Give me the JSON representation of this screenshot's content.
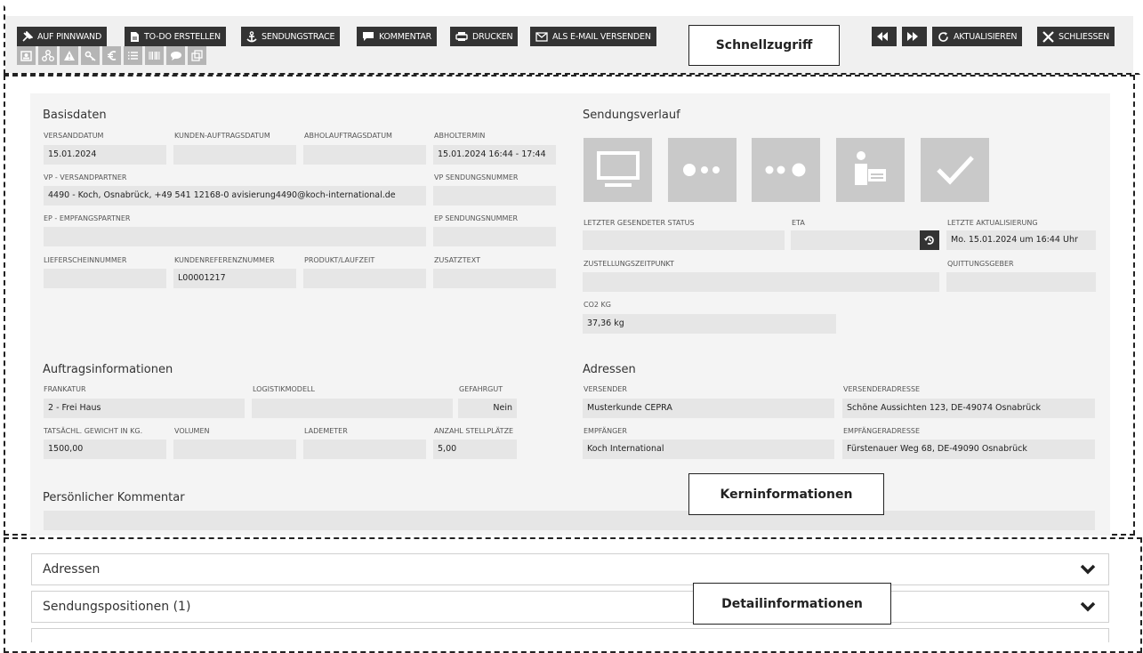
{
  "toolbar": {
    "pin": "AUF PINNWAND",
    "todo": "TO-DO ERSTELLEN",
    "trace": "SENDUNGSTRACE",
    "comment": "KOMMENTAR",
    "print": "DRUCKEN",
    "email": "ALS E-MAIL VERSENDEN",
    "refresh": "AKTUALISIEREN",
    "close": "SCHLIESSEN",
    "icon_row": [
      "contact-card-icon",
      "network-icon",
      "warning-icon",
      "key-icon",
      "euro-icon",
      "list-icon",
      "barcode-icon",
      "chat-icon",
      "duplicate-icon"
    ]
  },
  "callouts": {
    "quick": "Schnellzugriff",
    "core": "Kerninformationen",
    "detail": "Detailinformationen"
  },
  "basisdaten": {
    "title": "Basisdaten",
    "versanddatum_label": "VERSANDDATUM",
    "versanddatum": "15.01.2024",
    "kundenauftrag_label": "KUNDEN-AUFTRAGSDATUM",
    "kundenauftrag": "",
    "abholauftrag_label": "ABHOLAUFTRAGSDATUM",
    "abholauftrag": "",
    "abholtermin_label": "ABHOLTERMIN",
    "abholtermin": "15.01.2024 16:44 - 17:44",
    "vp_label": "VP - VERSANDPARTNER",
    "vp": "4490 - Koch, Osnabrück, +49 541 12168-0 avisierung4490@koch-international.de",
    "vp_nr_label": "VP SENDUNGSNUMMER",
    "vp_nr": "",
    "ep_label": "EP - EMPFANGSPARTNER",
    "ep": "",
    "ep_nr_label": "EP SENDUNGSNUMMER",
    "ep_nr": "",
    "lieferschein_label": "LIEFERSCHEINNUMMER",
    "lieferschein": "",
    "kundenref_label": "KUNDENREFERENZNUMMER",
    "kundenref": "L00001217",
    "produkt_label": "PRODUKT/LAUFZEIT",
    "produkt": "",
    "zusatz_label": "ZUSATZTEXT",
    "zusatz": ""
  },
  "verlauf": {
    "title": "Sendungsverlauf",
    "steps": [
      "computer-icon",
      "dots-partial-icon",
      "dots-icon",
      "delivery-person-icon",
      "checkmark-icon"
    ],
    "status_label": "LETZTER GESENDETER STATUS",
    "status": "",
    "eta_label": "ETA",
    "eta": "",
    "update_label": "LETZTE AKTUALISIERUNG",
    "update": "Mo. 15.01.2024 um 16:44 Uhr",
    "zustellung_label": "ZUSTELLUNGSZEITPUNKT",
    "zustellung": "",
    "quittung_label": "QUITTUNGSGEBER",
    "quittung": "",
    "co2_label": "CO2 KG",
    "co2": "37,36 kg"
  },
  "auftrag": {
    "title": "Auftragsinformationen",
    "frankatur_label": "FRANKATUR",
    "frankatur": "2 - Frei Haus",
    "logistik_label": "LOGISTIKMODELL",
    "logistik": "",
    "gefahrgut_label": "GEFAHRGUT",
    "gefahrgut": "Nein",
    "gewicht_label": "TATSÄCHL. GEWICHT IN KG.",
    "gewicht": "1500,00",
    "volumen_label": "VOLUMEN",
    "volumen": "",
    "lademeter_label": "LADEMETER",
    "lademeter": "",
    "stellplaetze_label": "ANZAHL STELLPLÄTZE",
    "stellplaetze": "5,00"
  },
  "adressen": {
    "title": "Adressen",
    "versender_label": "VERSENDER",
    "versender": "Musterkunde CEPRA",
    "versender_adr_label": "VERSENDERADRESSE",
    "versender_adr": "Schöne Aussichten 123, DE-49074 Osnabrück",
    "empf_label": "EMPFÄNGER",
    "empf": "Koch International",
    "empf_adr_label": "EMPFÄNGERADRESSE",
    "empf_adr": "Fürstenauer Weg 68, DE-49090 Osnabrück"
  },
  "kommentar": {
    "title": "Persönlicher Kommentar",
    "value": ""
  },
  "accordion": {
    "adressen": "Adressen",
    "positionen": "Sendungspositionen (1)"
  }
}
